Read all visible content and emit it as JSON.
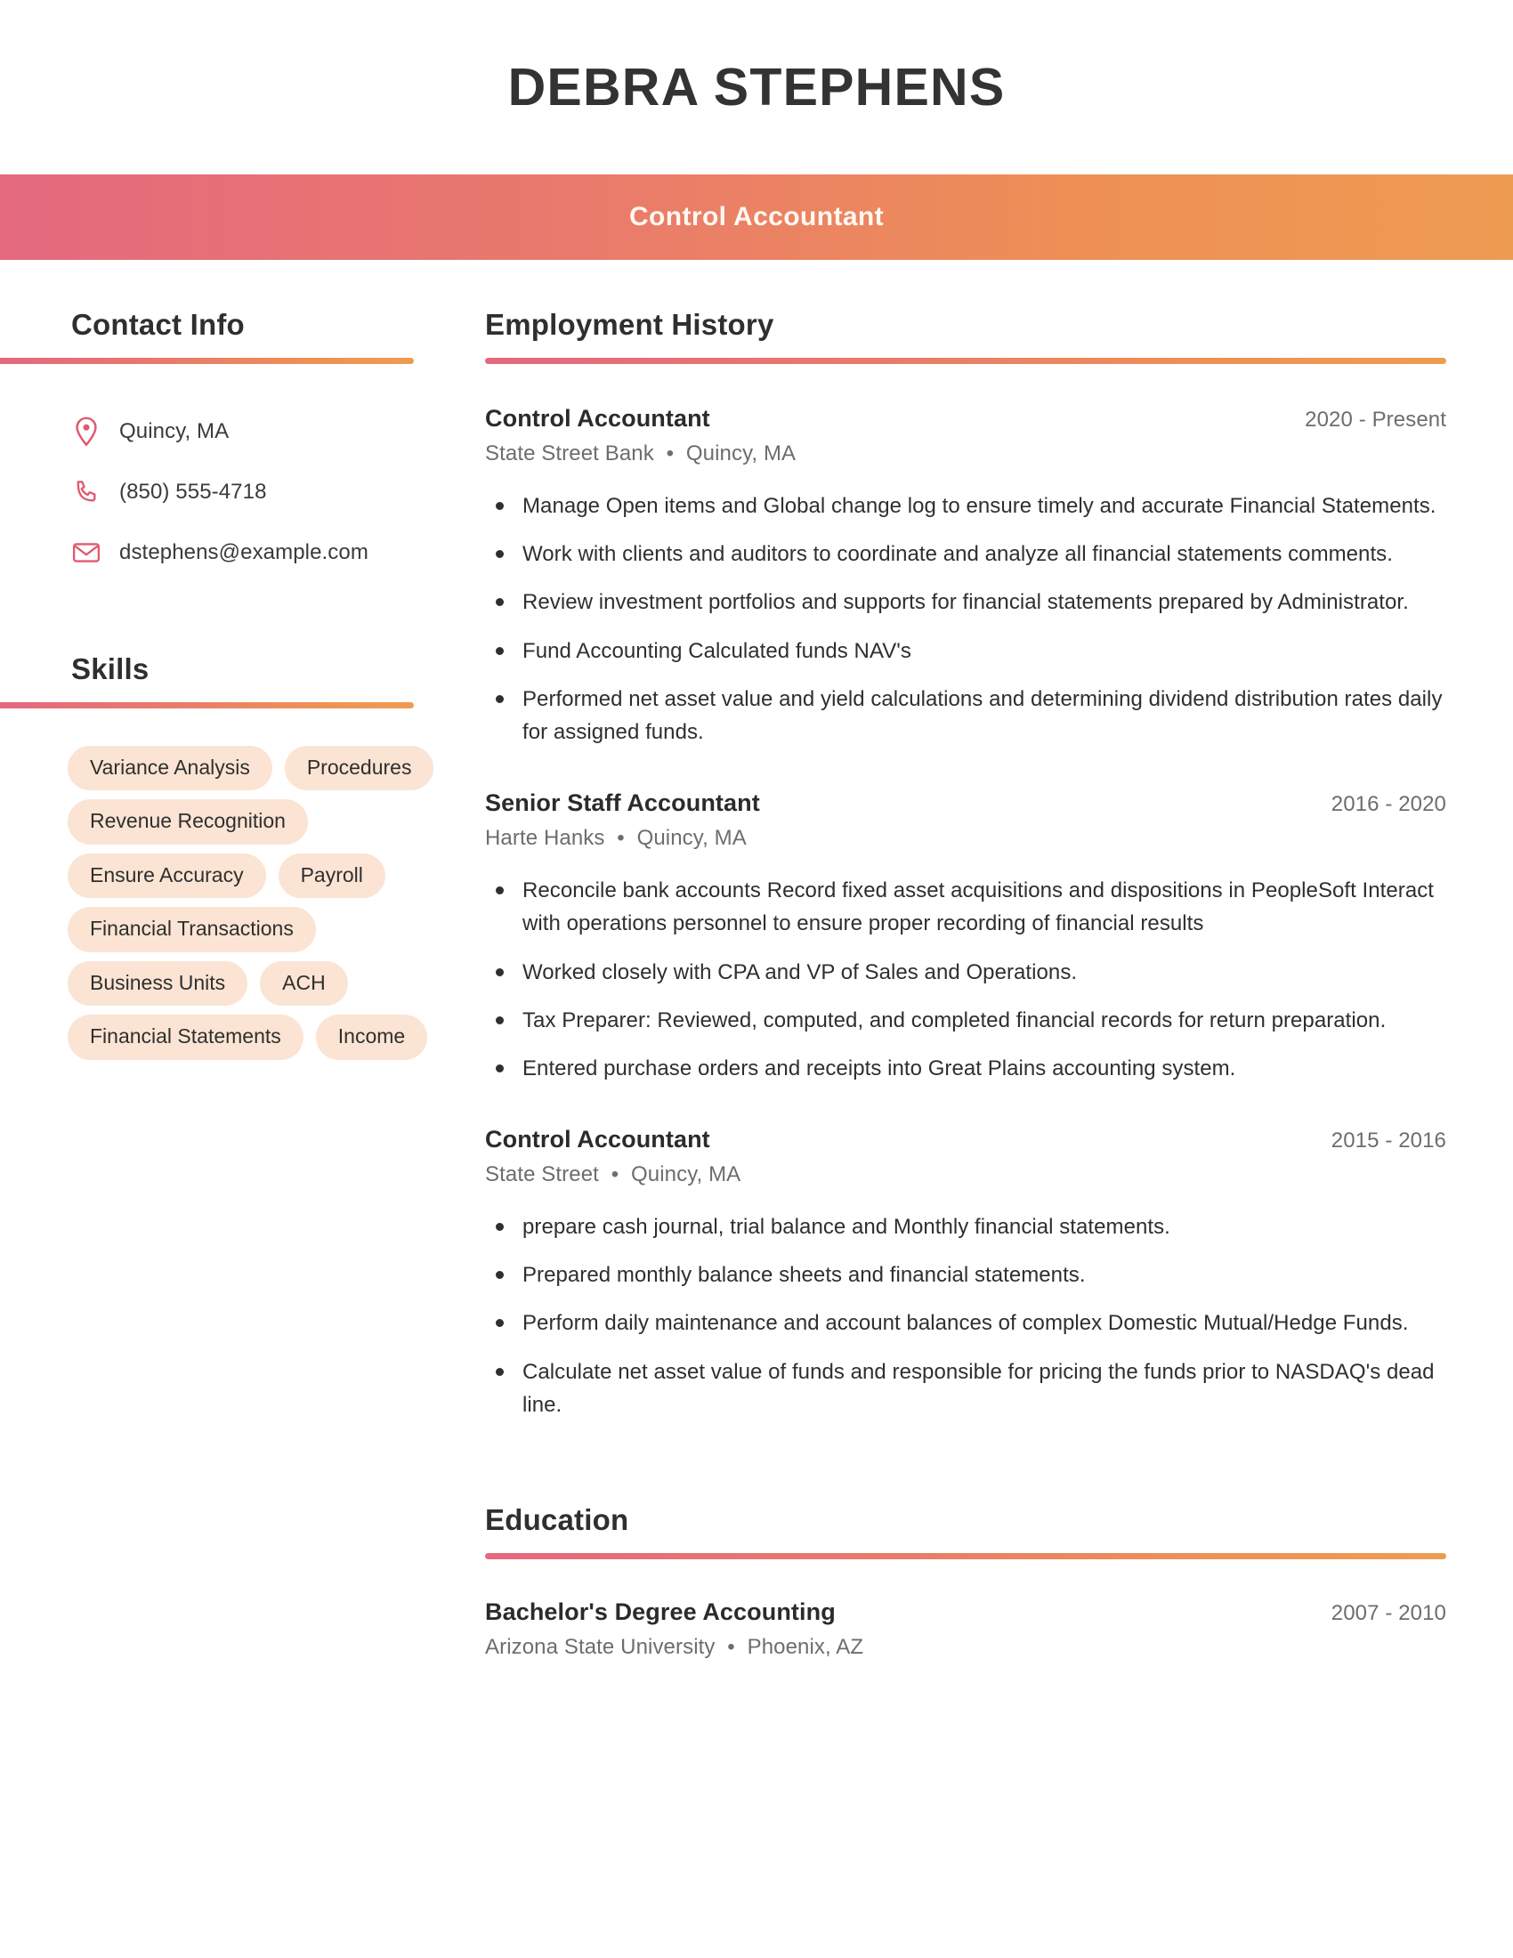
{
  "header": {
    "full_name": "DEBRA STEPHENS",
    "job_title": "Control Accountant",
    "gradient_start": "#E4697E",
    "gradient_end": "#EE9B52"
  },
  "sidebar": {
    "contact": {
      "heading": "Contact Info",
      "items": [
        {
          "icon": "location-pin-icon",
          "value": "Quincy, MA"
        },
        {
          "icon": "phone-icon",
          "value": "(850) 555-4718"
        },
        {
          "icon": "envelope-icon",
          "value": "dstephens@example.com"
        }
      ]
    },
    "skills": {
      "heading": "Skills",
      "pill_bg": "#FBE4D3",
      "items": [
        "Variance Analysis",
        "Procedures",
        "Revenue Recognition",
        "Ensure Accuracy",
        "Payroll",
        "Financial Transactions",
        "Business Units",
        "ACH",
        "Financial Statements",
        "Income"
      ]
    }
  },
  "main": {
    "employment": {
      "heading": "Employment History",
      "entries": [
        {
          "title": "Control Accountant",
          "dates": "2020 - Present",
          "company": "State Street Bank",
          "location": "Quincy, MA",
          "bullets": [
            "Manage Open items and Global change log to ensure timely and accurate Financial Statements.",
            "Work with clients and auditors to coordinate and analyze all financial statements comments.",
            "Review investment portfolios and supports for financial statements prepared by Administrator.",
            "Fund Accounting Calculated funds NAV's",
            "Performed net asset value and yield calculations and determining dividend distribution rates daily for assigned funds."
          ]
        },
        {
          "title": "Senior Staff Accountant",
          "dates": "2016 - 2020",
          "company": "Harte Hanks",
          "location": "Quincy, MA",
          "bullets": [
            "Reconcile bank accounts Record fixed asset acquisitions and dispositions in PeopleSoft Interact with operations personnel to ensure proper recording of financial results",
            "Worked closely with CPA and VP of Sales and Operations.",
            "Tax Preparer: Reviewed, computed, and completed financial records for return preparation.",
            "Entered purchase orders and receipts into Great Plains accounting system."
          ]
        },
        {
          "title": "Control Accountant",
          "dates": "2015 - 2016",
          "company": "State Street",
          "location": "Quincy, MA",
          "bullets": [
            "prepare cash journal, trial balance and Monthly financial statements.",
            "Prepared monthly balance sheets and financial statements.",
            "Perform daily maintenance and account balances of complex Domestic Mutual/Hedge Funds.",
            "Calculate net asset value of funds and responsible for pricing the funds prior to NASDAQ's dead line."
          ]
        }
      ]
    },
    "education": {
      "heading": "Education",
      "entries": [
        {
          "degree": "Bachelor's Degree Accounting",
          "dates": "2007 - 2010",
          "school": "Arizona State University",
          "location": "Phoenix, AZ"
        }
      ]
    }
  }
}
